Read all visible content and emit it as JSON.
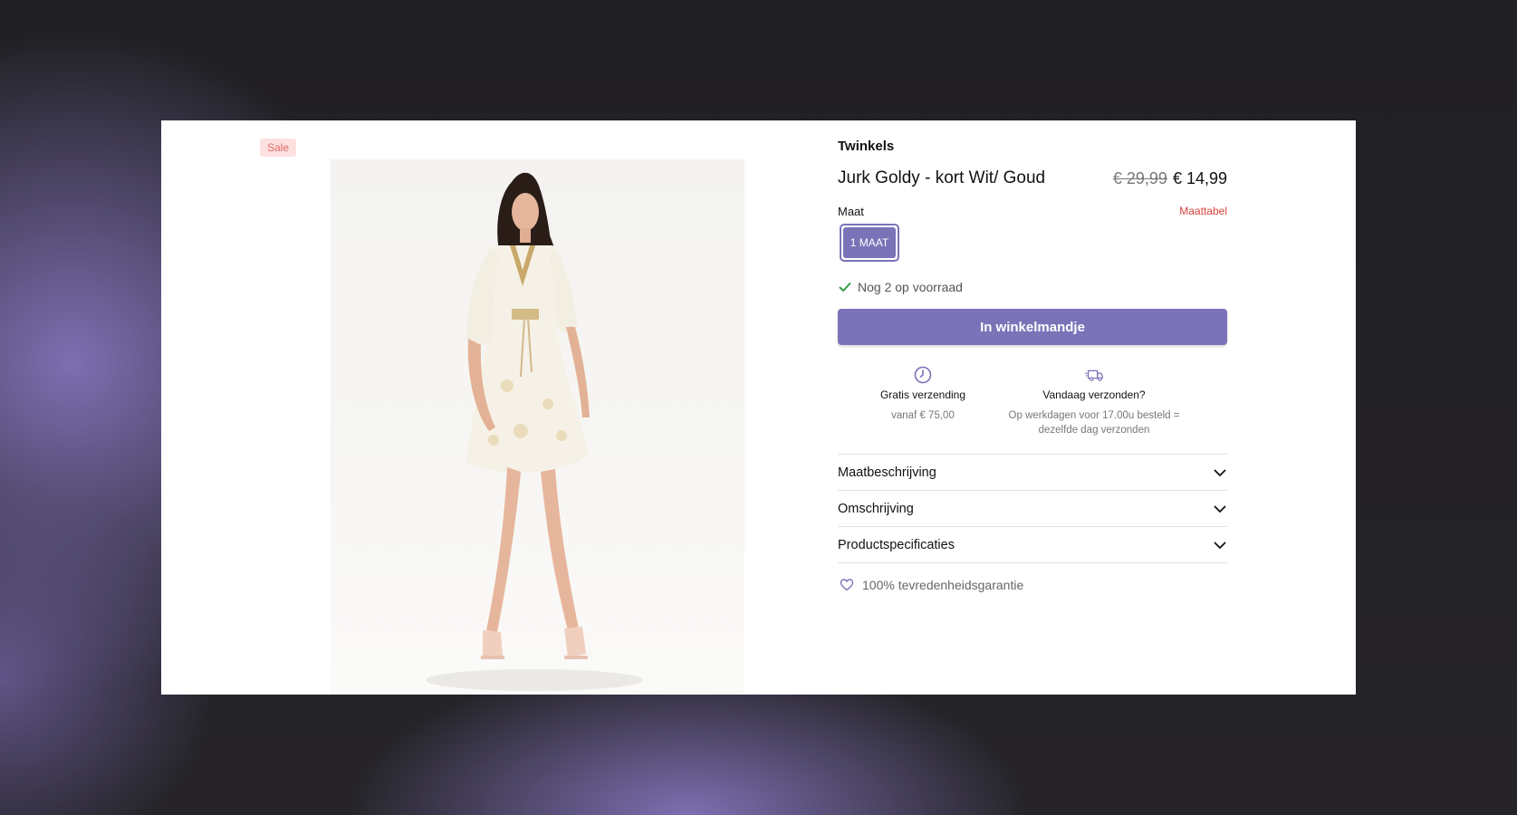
{
  "badge": {
    "label": "Sale",
    "color": "#e06a6a"
  },
  "product": {
    "brand": "Twinkels",
    "title": "Jurk Goldy - kort Wit/ Goud",
    "old_price": "€ 29,99",
    "price": "€ 14,99",
    "image_alt": "model in white and gold short dress"
  },
  "size": {
    "label": "Maat",
    "chart_link": "Maattabel",
    "options": [
      "1 MAAT"
    ],
    "selected": "1 MAAT"
  },
  "stock": {
    "text": "Nog 2 op voorraad",
    "icon": "check-icon"
  },
  "cart_button": {
    "label": "In winkelmandje"
  },
  "usps": [
    {
      "icon": "clock-icon",
      "title": "Gratis verzending",
      "subtitle": "vanaf € 75,00"
    },
    {
      "icon": "truck-icon",
      "title": "Vandaag verzonden?",
      "subtitle": "Op werkdagen voor 17.00u besteld = dezelfde dag verzonden"
    }
  ],
  "accordions": [
    {
      "label": "Maatbeschrijving"
    },
    {
      "label": "Omschrijving"
    },
    {
      "label": "Productspecificaties"
    }
  ],
  "guarantee": {
    "text": "100% tevredenheidsgarantie",
    "icon": "heart-icon"
  },
  "colors": {
    "accent": "#7a73b8",
    "sale": "#d7443c",
    "stock_check": "#2f9e4a"
  }
}
